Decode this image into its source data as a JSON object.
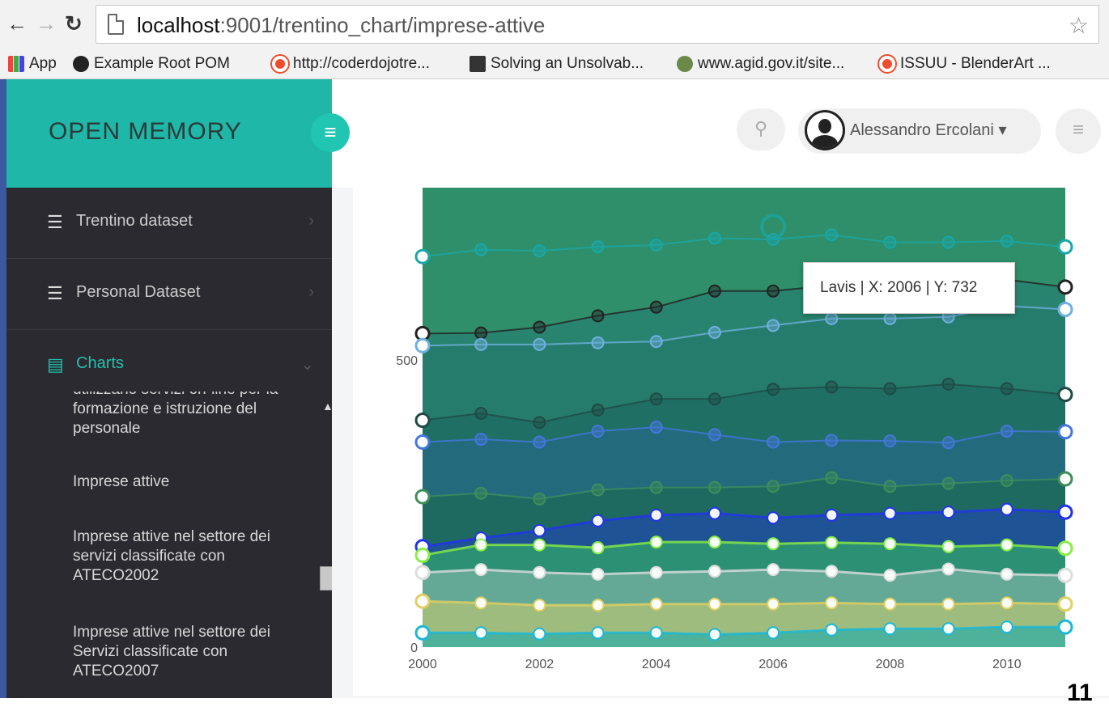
{
  "browser": {
    "url_prefix": "localhost",
    "url_rest": ":9001/trentino_chart/imprese-attive",
    "bookmarks": [
      {
        "label": "App",
        "icon": "apps-grid-icon"
      },
      {
        "label": "Example Root POM",
        "icon": "github-icon"
      },
      {
        "label": "http://coderdojotre...",
        "icon": "target-icon"
      },
      {
        "label": "Solving an Unsolvab...",
        "icon": "pin-icon"
      },
      {
        "label": "www.agid.gov.it/site...",
        "icon": "emblem-icon"
      },
      {
        "label": "ISSUU - BlenderArt ...",
        "icon": "target-icon"
      }
    ]
  },
  "sidebar": {
    "brand": "OPEN MEMORY",
    "items": [
      {
        "label": "Trentino dataset",
        "icon": "database-icon"
      },
      {
        "label": "Personal Dataset",
        "icon": "database-icon"
      },
      {
        "label": "Charts",
        "icon": "bar-chart-icon"
      }
    ],
    "submenu": [
      "utilizzano servizi on-line per la formazione e istruzione del personale",
      "Imprese attive",
      "Imprese attive nel settore dei servizi classificate con ATECO2002",
      "Imprese attive nel settore dei Servizi classificate con ATECO2007"
    ]
  },
  "header": {
    "user_name": "Alessandro Ercolani",
    "caret": "▾"
  },
  "tooltip": "Lavis | X: 2006 | Y: 732",
  "page_number": "11",
  "chart_data": {
    "type": "area",
    "x": [
      2000,
      2001,
      2002,
      2003,
      2004,
      2005,
      2006,
      2007,
      2008,
      2009,
      2010,
      2011
    ],
    "xticks": [
      2000,
      2002,
      2004,
      2006,
      2008,
      2010
    ],
    "yticks": [
      0,
      500
    ],
    "ylim": [
      0,
      800
    ],
    "xlim": [
      2000,
      2011
    ],
    "highlight": {
      "x": 2006,
      "y": 732
    },
    "series": [
      {
        "color": "#1aa7a7",
        "fill": "#2e8f6a",
        "values": [
          680,
          692,
          690,
          697,
          700,
          712,
          710,
          718,
          705,
          705,
          707,
          697
        ]
      },
      {
        "color": "#222222",
        "fill": "#288270",
        "values": [
          546,
          547,
          557,
          577,
          592,
          620,
          620,
          630,
          630,
          626,
          640,
          627
        ]
      },
      {
        "color": "#6fb0e0",
        "fill": "#267a6c",
        "values": [
          525,
          527,
          527,
          530,
          532,
          548,
          560,
          572,
          572,
          575,
          594,
          588
        ]
      },
      {
        "color": "#1f4a46",
        "fill": "#1f6d64",
        "values": [
          395,
          407,
          391,
          413,
          432,
          432,
          449,
          453,
          450,
          458,
          450,
          440
        ]
      },
      {
        "color": "#4477dd",
        "fill": "#246b80",
        "values": [
          357,
          362,
          357,
          376,
          383,
          370,
          357,
          360,
          359,
          356,
          376,
          375
        ]
      },
      {
        "color": "#3e8f5c",
        "fill": "#1e6a5c",
        "values": [
          262,
          268,
          258,
          274,
          278,
          278,
          280,
          295,
          280,
          285,
          290,
          293
        ]
      },
      {
        "color": "#2233ee",
        "fill": "#1f4fa0",
        "values": [
          175,
          190,
          203,
          220,
          230,
          233,
          225,
          230,
          233,
          235,
          240,
          235
        ]
      },
      {
        "color": "#88ee44",
        "fill": "#2f9b70",
        "values": [
          160,
          178,
          178,
          173,
          183,
          183,
          180,
          182,
          180,
          175,
          178,
          172
        ]
      },
      {
        "color": "#dddddd",
        "fill": "#6fae9c",
        "values": [
          130,
          135,
          130,
          127,
          130,
          132,
          135,
          132,
          125,
          136,
          127,
          125
        ]
      },
      {
        "color": "#e0d060",
        "fill": "#a8c07a",
        "values": [
          80,
          77,
          73,
          73,
          75,
          75,
          75,
          77,
          75,
          75,
          77,
          75
        ]
      },
      {
        "color": "#1ab8d8",
        "fill": "#3fb0a0",
        "values": [
          25,
          25,
          23,
          25,
          25,
          22,
          25,
          30,
          32,
          32,
          35,
          35
        ]
      }
    ]
  }
}
